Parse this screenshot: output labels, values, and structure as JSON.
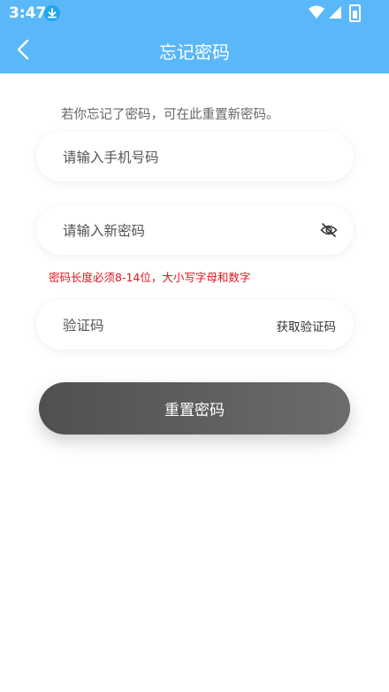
{
  "status_bar": {
    "time": "3:47"
  },
  "header": {
    "title": "忘记密码"
  },
  "form": {
    "hint": "若你忘记了密码，可在此重置新密码。",
    "phone_placeholder": "请输入手机号码",
    "password_placeholder": "请输入新密码",
    "password_rule": "密码长度必须8-14位，大小写字母和数字",
    "code_placeholder": "验证码",
    "get_code_label": "获取验证码",
    "submit_label": "重置密码"
  },
  "colors": {
    "header_bg": "#5bb8f8",
    "error": "#e0141e",
    "button_bg": "#5a5a5a"
  },
  "icons": {
    "back": "chevron-left-icon",
    "password_toggle": "eye-off-icon",
    "download": "download-icon"
  }
}
